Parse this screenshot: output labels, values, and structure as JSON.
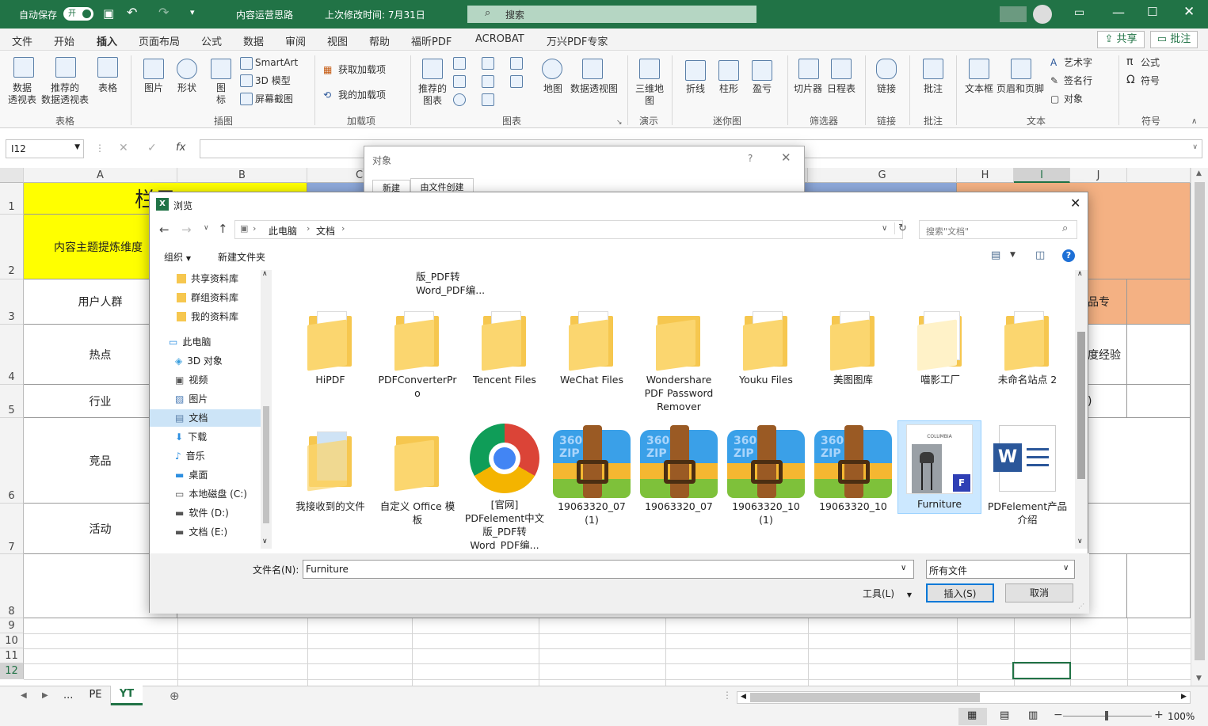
{
  "titlebar": {
    "autosave_label": "自动保存",
    "autosave_state": "开",
    "doc_title": "内容运营思路",
    "last_modified": "上次修改时间: 7月31日",
    "search_placeholder": "搜索"
  },
  "menu": [
    "文件",
    "开始",
    "插入",
    "页面布局",
    "公式",
    "数据",
    "审阅",
    "视图",
    "帮助",
    "福昕PDF",
    "ACROBAT",
    "万兴PDF专家"
  ],
  "share_label": "共享",
  "comment_label": "批注",
  "ribbon": {
    "pivot": "数据\n透视表",
    "rec_pivot": "推荐的\n数据透视表",
    "table": "表格",
    "picture": "图片",
    "shape": "形状",
    "icon": "图\n标",
    "smartart": "SmartArt",
    "model3d": "3D 模型",
    "screenshot": "屏幕截图",
    "get_addin": "获取加载项",
    "my_addin": "我的加载项",
    "rec_chart": "推荐的\n图表",
    "map": "地图",
    "pivot_chart": "数据透视图",
    "map3d": "三维地\n图",
    "line": "折线",
    "column": "柱形",
    "winloss": "盈亏",
    "slicer": "切片器",
    "timeline": "日程表",
    "link": "链接",
    "comment": "批注",
    "textbox": "文本框",
    "header_footer": "页眉和页脚",
    "wordart": "艺术字",
    "signature": "签名行",
    "object": "对象",
    "equation": "公式",
    "symbol": "符号",
    "groups": [
      "表格",
      "插图",
      "加载项",
      "图表",
      "演示",
      "迷你图",
      "筛选器",
      "链接",
      "批注",
      "文本",
      "符号"
    ]
  },
  "formula": {
    "namebox": "I12",
    "fx": "fx"
  },
  "columns": [
    "A",
    "B",
    "C",
    "D",
    "E",
    "F",
    "G",
    "H",
    "I",
    "J"
  ],
  "rows": [
    "1",
    "2",
    "3",
    "4",
    "5",
    "6",
    "7",
    "8",
    "9",
    "10",
    "11",
    "12"
  ],
  "cells": {
    "a1": "栏目",
    "a2": "内容主题提炼维度",
    "a3": "用户人群",
    "a4": "热点",
    "a5": "行业",
    "a6": "竞品",
    "a7": "活动",
    "j3": "品专",
    "j4": "度经验",
    "j5": ")"
  },
  "sheet_tabs": [
    "...",
    "PE",
    "YT"
  ],
  "zoom": "100%",
  "object_dialog": {
    "title": "对象",
    "help": "?",
    "tabs": [
      "新建",
      "由文件创建"
    ]
  },
  "browse": {
    "title": "浏览",
    "path": [
      "此电脑",
      "文档"
    ],
    "search_placeholder": "搜索\"文档\"",
    "organize": "组织",
    "new_folder": "新建文件夹",
    "nav": [
      "共享资料库",
      "群组资料库",
      "我的资料库",
      "此电脑",
      "3D 对象",
      "视频",
      "图片",
      "文档",
      "下载",
      "音乐",
      "桌面",
      "本地磁盘 (C:)",
      "软件 (D:)",
      "文档 (E:)"
    ],
    "partial_top": "版_PDF转\nWord_PDF编...",
    "files_row1": [
      "HiPDF",
      "PDFConverterPr\no",
      "Tencent Files",
      "WeChat Files",
      "Wondershare\nPDF Password\nRemover",
      "Youku Files",
      "美图图库",
      "喵影工厂",
      "未命名站点 2"
    ],
    "files_row2": [
      "我接收到的文件",
      "自定义 Office 模\n板",
      "[官网]\nPDFelement中文\n版_PDF转\nWord_PDF编...",
      "19063320_07\n(1)",
      "19063320_07",
      "19063320_10\n(1)",
      "19063320_10",
      "Furniture",
      "PDFelement产品\n介绍"
    ],
    "zip_label": "360\nZIP",
    "furniture_brand": "COLUMBIA",
    "filename_label": "文件名(N):",
    "filename_value": "Furniture",
    "filetype": "所有文件",
    "tools": "工具(L)",
    "insert": "插入(S)",
    "cancel": "取消"
  }
}
